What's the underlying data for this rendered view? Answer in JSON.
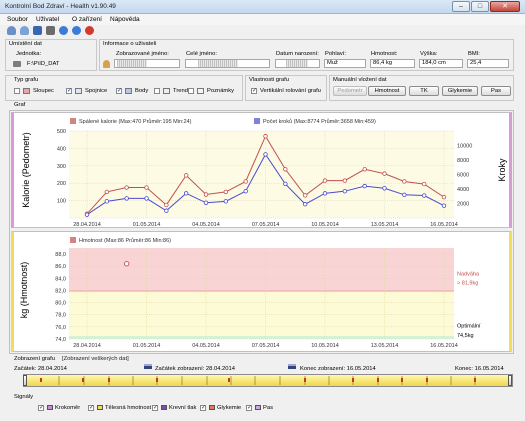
{
  "window": {
    "title": "Kontrolní Bod Zdraví - Health v1.90.49",
    "min_glyph": "–",
    "max_glyph": "□",
    "close_glyph": "✕"
  },
  "menu": [
    "Soubor",
    "Uživatel",
    "O zařízení",
    "Nápověda"
  ],
  "toolbar": {
    "icons": [
      "user-icon",
      "users-icon",
      "save-icon",
      "device-icon",
      "info-icon",
      "help-icon",
      "stop-icon"
    ],
    "colors": [
      "#6b8fc7",
      "#7aa3d8",
      "#3a65b0",
      "#6c6c6c",
      "#3c7bd6",
      "#3c7bd6",
      "#d23a2a"
    ]
  },
  "data_location": {
    "heading": "Umístění dat",
    "label": "Jednotka:",
    "value": "F:\\P\\ID_DAT"
  },
  "user_info": {
    "heading": "Informace o uživateli",
    "display_name_label": "Zobrazované jméno:",
    "full_name_label": "Celé jméno:",
    "birth_date_label": "Datum narození:",
    "sex_label": "Pohlaví:",
    "sex_value": "Muž",
    "weight_label": "Hmotnost:",
    "weight_value": "86,4 kg",
    "height_label": "Výška:",
    "height_value": "184,0 cm",
    "bmi_label": "BMI:",
    "bmi_value": "25,4"
  },
  "graph_type": {
    "heading": "Typ grafu",
    "options": [
      {
        "label": "Sloupec",
        "checked": false
      },
      {
        "label": "Spojnice",
        "checked": true
      },
      {
        "label": "Body",
        "checked": true
      },
      {
        "label": "Trend",
        "checked": false
      },
      {
        "label": "Poznámky",
        "checked": false
      }
    ]
  },
  "graph_props": {
    "heading": "Vlastnosti grafu",
    "vertical_scroll_label": "Vertikální rolování grafu",
    "vertical_scroll_checked": true
  },
  "manual_entry": {
    "heading": "Manuální vložení dat",
    "buttons": [
      {
        "label": "Pedometr",
        "disabled": true
      },
      {
        "label": "Hmotnost",
        "disabled": false
      },
      {
        "label": "TK",
        "disabled": false
      },
      {
        "label": "Glykemie",
        "disabled": false
      },
      {
        "label": "Pas",
        "disabled": false
      }
    ]
  },
  "graph_panel": {
    "heading": "Graf"
  },
  "chart_data": [
    {
      "type": "line",
      "ylabel": "Kalorie (Pedometr)",
      "y2label": "Kroky",
      "ylim": [
        0,
        500
      ],
      "y2lim": [
        0,
        12000
      ],
      "yticks": [
        "100",
        "200",
        "300",
        "400",
        "500"
      ],
      "y2ticks": [
        "2000",
        "4000",
        "6000",
        "8000",
        "10000"
      ],
      "xticks": [
        "28.04.2014",
        "01.05.2014",
        "04.05.2014",
        "07.05.2014",
        "10.05.2014",
        "13.05.2014",
        "16.05.2014"
      ],
      "grid": true,
      "series": [
        {
          "name": "Spálené kalorie (Max:470 Průměr:195 Min:24)",
          "color": "#c0504d",
          "axis": "left",
          "x": [
            "28.04.2014",
            "29.04.2014",
            "30.04.2014",
            "01.05.2014",
            "02.05.2014",
            "03.05.2014",
            "04.05.2014",
            "05.05.2014",
            "06.05.2014",
            "07.05.2014",
            "08.05.2014",
            "09.05.2014",
            "10.05.2014",
            "11.05.2014",
            "12.05.2014",
            "13.05.2014",
            "14.05.2014",
            "15.05.2014",
            "16.05.2014"
          ],
          "values": [
            24,
            150,
            175,
            175,
            75,
            245,
            135,
            150,
            210,
            470,
            280,
            130,
            215,
            215,
            280,
            255,
            210,
            195,
            120
          ]
        },
        {
          "name": "Počet kroků (Max:8774 Průměr:3658 Min:459)",
          "color": "#4a4acf",
          "axis": "right",
          "x": [
            "28.04.2014",
            "29.04.2014",
            "30.04.2014",
            "01.05.2014",
            "02.05.2014",
            "03.05.2014",
            "04.05.2014",
            "05.05.2014",
            "06.05.2014",
            "07.05.2014",
            "08.05.2014",
            "09.05.2014",
            "10.05.2014",
            "11.05.2014",
            "12.05.2014",
            "13.05.2014",
            "14.05.2014",
            "15.05.2014",
            "16.05.2014"
          ],
          "values": [
            459,
            2300,
            2700,
            2700,
            1000,
            3400,
            2100,
            2300,
            3700,
            8774,
            4700,
            1900,
            3400,
            3700,
            4400,
            4100,
            3200,
            3100,
            1700
          ]
        }
      ]
    },
    {
      "type": "scatter",
      "ylabel": "kg (Hmotnost)",
      "ylim": [
        74.0,
        89.0
      ],
      "yticks": [
        "74,0",
        "76,0",
        "78,0",
        "80,0",
        "82,0",
        "84,0",
        "86,0",
        "88,0"
      ],
      "xticks": [
        "28.04.2014",
        "01.05.2014",
        "04.05.2014",
        "07.05.2014",
        "10.05.2014",
        "13.05.2014",
        "16.05.2014"
      ],
      "grid": true,
      "series": [
        {
          "name": "Hmotnost (Max:86 Průměr:86 Min:86)",
          "color": "#c0504d",
          "x": [
            "30.04.2014"
          ],
          "values": [
            86.4
          ]
        }
      ],
      "annotations": [
        {
          "text": "Nadváha",
          "color": "#c0504d"
        },
        {
          "text": "> 81,9kg",
          "color": "#c0504d"
        },
        {
          "text": "Optimální",
          "color": "#000000"
        },
        {
          "text": "74,5kg",
          "color": "#000000"
        }
      ],
      "bands": [
        {
          "from": 81.9,
          "to": 89.0,
          "color": "#f8d4d4"
        },
        {
          "from": 74.5,
          "to": 81.9,
          "color": "#fdfbd6"
        },
        {
          "from": 74.0,
          "to": 74.5,
          "color": "#d6f2d6"
        }
      ]
    }
  ],
  "display": {
    "heading": "Zobrazení grafu",
    "all_data_link": "[Zobrazení veškerých dat]",
    "start_label": "Začátek: 28.04.2014",
    "view_start_label": "Začátek zobrazení: 28.04.2014",
    "view_end_label": "Konec zobrazení: 16.05.2014",
    "end_label": "Konec: 16.05.2014"
  },
  "signals": {
    "heading": "Signály",
    "items": [
      {
        "label": "Krokoměr",
        "color": "#c28ad8"
      },
      {
        "label": "Tělesná hmotnost",
        "color": "#f3dc5a"
      },
      {
        "label": "Krevní tlak",
        "color": "#7c4cb0"
      },
      {
        "label": "Glykemie",
        "color": "#e07a5f"
      },
      {
        "label": "Pas",
        "color": "#c9a9e3"
      }
    ]
  }
}
